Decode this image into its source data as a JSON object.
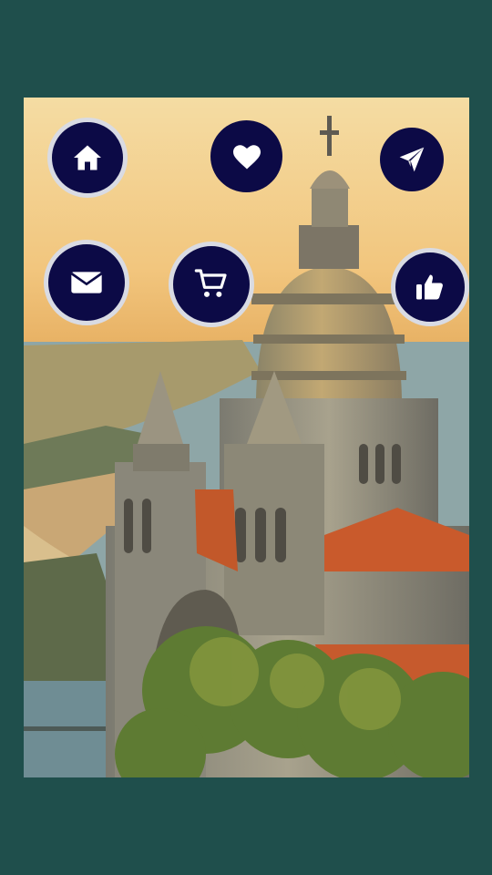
{
  "screen": {
    "background_color": "#1f4f4c",
    "photo": {
      "subject": "sunset-cathedral-over-coastline"
    }
  },
  "buttons": [
    {
      "icon": "home-icon",
      "color": "#0c0a46"
    },
    {
      "icon": "heart-icon",
      "color": "#0c0a46"
    },
    {
      "icon": "paper-plane-icon",
      "color": "#0c0a46"
    },
    {
      "icon": "mail-icon",
      "color": "#0c0a46"
    },
    {
      "icon": "cart-icon",
      "color": "#0c0a46"
    },
    {
      "icon": "thumbs-up-icon",
      "color": "#0c0a46"
    }
  ]
}
